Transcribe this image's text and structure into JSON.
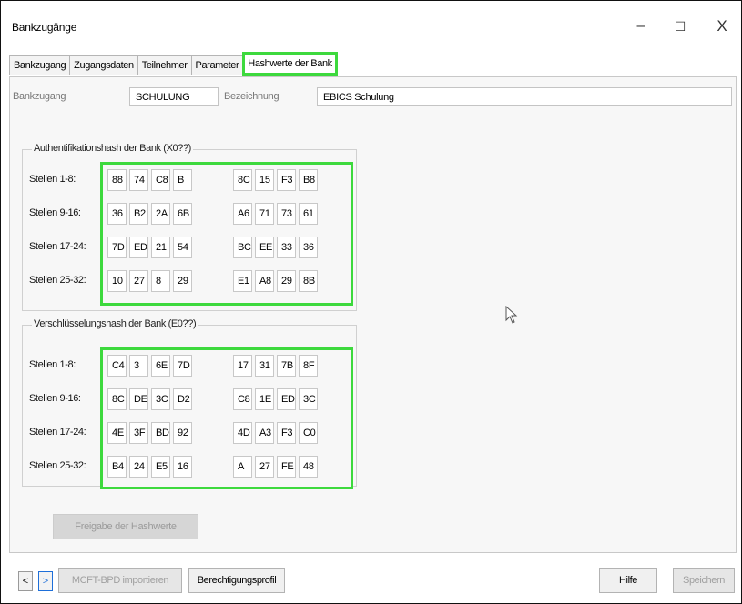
{
  "window": {
    "title": "Bankzugänge",
    "minimize_glyph": "–",
    "maximize_glyph": "☐",
    "close_glyph": "X"
  },
  "tabs": [
    {
      "label": "Bankzugang"
    },
    {
      "label": "Zugangsdaten"
    },
    {
      "label": "Teilnehmer"
    },
    {
      "label": "Parameter"
    },
    {
      "label": "Hashwerte der Bank",
      "active": true
    }
  ],
  "header": {
    "bankzugang_label": "Bankzugang",
    "bankzugang_value": "SCHULUNG",
    "bezeichnung_label": "Bezeichnung",
    "bezeichnung_value": "EBICS Schulung"
  },
  "auth_hash": {
    "legend": "Authentifikationshash der Bank (X0??)",
    "rows": [
      {
        "label": "Stellen 1-8:",
        "cells": [
          "88",
          "74",
          "C8",
          "B",
          "8C",
          "15",
          "F3",
          "B8"
        ]
      },
      {
        "label": "Stellen 9-16:",
        "cells": [
          "36",
          "B2",
          "2A",
          "6B",
          "A6",
          "71",
          "73",
          "61"
        ]
      },
      {
        "label": "Stellen 17-24:",
        "cells": [
          "7D",
          "ED",
          "21",
          "54",
          "BC",
          "EE",
          "33",
          "36"
        ]
      },
      {
        "label": "Stellen 25-32:",
        "cells": [
          "10",
          "27",
          "8",
          "29",
          "E1",
          "A8",
          "29",
          "8B"
        ]
      }
    ]
  },
  "enc_hash": {
    "legend": "Verschlüsselungshash der Bank (E0??)",
    "rows": [
      {
        "label": "Stellen 1-8:",
        "cells": [
          "C4",
          "3",
          "6E",
          "7D",
          "17",
          "31",
          "7B",
          "8F"
        ]
      },
      {
        "label": "Stellen 9-16:",
        "cells": [
          "8C",
          "DE",
          "3C",
          "D2",
          "C8",
          "1E",
          "ED",
          "3C"
        ]
      },
      {
        "label": "Stellen 17-24:",
        "cells": [
          "4E",
          "3F",
          "BD",
          "92",
          "4D",
          "A3",
          "F3",
          "C0"
        ]
      },
      {
        "label": "Stellen 25-32:",
        "cells": [
          "B4",
          "24",
          "E5",
          "16",
          "A",
          "27",
          "FE",
          "48"
        ]
      }
    ]
  },
  "freigabe_label": "Freigabe der Hashwerte",
  "footer": {
    "prev_glyph": "<",
    "next_glyph": ">",
    "import_label": "MCFT-BPD importieren",
    "profil_label": "Berechtigungsprofil",
    "hilfe_label": "Hilfe",
    "speichern_label": "Speichern"
  },
  "accent_color": "#3dd93d"
}
